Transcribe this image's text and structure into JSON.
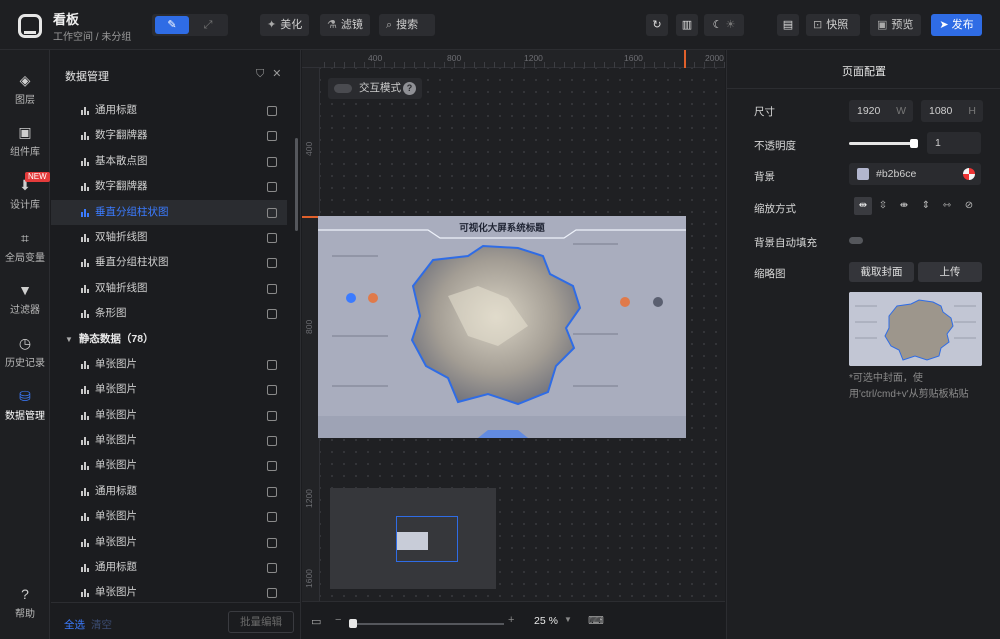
{
  "header": {
    "app_title": "看板",
    "breadcrumb": "工作空间 / 未分组",
    "beautify": "美化",
    "filter": "滤镜",
    "search": "搜索",
    "snapshot": "快照",
    "preview": "预览",
    "publish": "发布"
  },
  "rail": {
    "layers": "图层",
    "components": "组件库",
    "design": "设计库",
    "new_badge": "NEW",
    "variables": "全局变量",
    "filters": "过滤器",
    "history": "历史记录",
    "data": "数据管理",
    "help": "帮助"
  },
  "panel": {
    "title": "数据管理",
    "items_top": [
      "通用标题",
      "数字翻牌器",
      "基本散点图",
      "数字翻牌器",
      "垂直分组柱状图",
      "双轴折线图",
      "垂直分组柱状图",
      "双轴折线图",
      "条形图"
    ],
    "selected_index": 4,
    "group_label": "静态数据（78）",
    "items_bottom": [
      "单张图片",
      "单张图片",
      "单张图片",
      "单张图片",
      "单张图片",
      "通用标题",
      "单张图片",
      "单张图片",
      "通用标题",
      "单张图片"
    ],
    "select_all": "全选",
    "clear": "清空",
    "batch_edit": "批量编辑"
  },
  "canvas": {
    "interact_mode": "交互模式",
    "artboard_title": "可视化大屏系统标题",
    "zoom": "25 %",
    "ruler_h": [
      "400",
      "800",
      "1200",
      "1600",
      "2000"
    ],
    "ruler_v": [
      "400",
      "800",
      "1200",
      "1600"
    ]
  },
  "config": {
    "title": "页面配置",
    "size_label": "尺寸",
    "width": "1920",
    "width_unit": "W",
    "height": "1080",
    "height_unit": "H",
    "opacity_label": "不透明度",
    "opacity_value": "1",
    "opacity": 1,
    "bg_label": "背景",
    "bg_color": "#b2b6ce",
    "scale_label": "缩放方式",
    "autofill_label": "背景自动填充",
    "thumb_label": "缩略图",
    "capture": "截取封面",
    "upload": "上传",
    "note": "*可选中封面，使用'ctrl/cmd+v'从剪贴板粘贴"
  }
}
